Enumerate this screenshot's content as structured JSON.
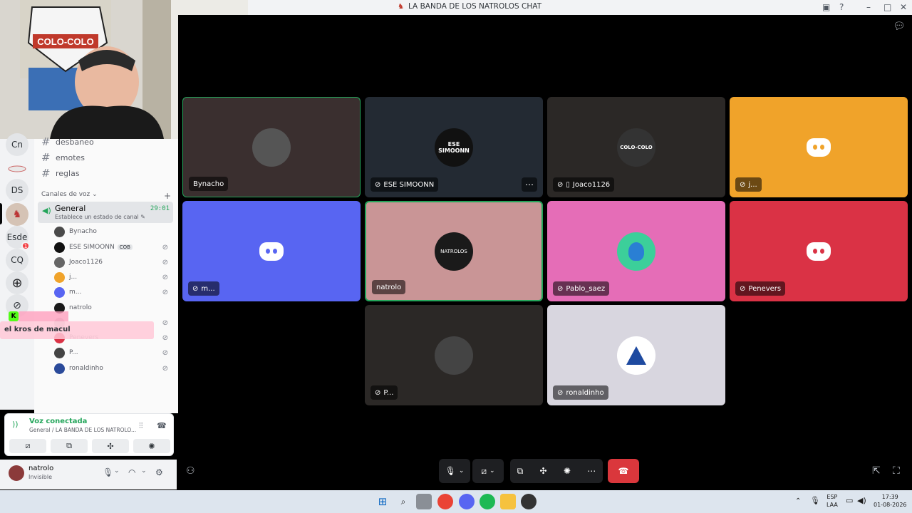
{
  "window": {
    "title": "LA BANDA DE LOS NATROLOS CHAT"
  },
  "servers": [
    "Cn",
    "DS",
    "Esde",
    "CQ"
  ],
  "server_badge": "1",
  "text_channels": [
    "desbaneo",
    "emotes",
    "reglas"
  ],
  "voice_category": "Canales de voz",
  "active_voice": {
    "name": "General",
    "status": "Establece un estado de canal",
    "timer": "29:01"
  },
  "voice_users": [
    {
      "name": "Bynacho"
    },
    {
      "name": "ESE SIMOONN",
      "tag": "COB"
    },
    {
      "name": "Joaco1126"
    },
    {
      "name": "j..."
    },
    {
      "name": "m..."
    },
    {
      "name": "natrolo"
    },
    {
      "name": "Penevers"
    },
    {
      "name": "P..."
    },
    {
      "name": "ronaldinho"
    }
  ],
  "overlay_text": "el kros de macul",
  "voice_panel": {
    "title": "Voz conectada",
    "subtitle": "General / LA BANDA DE LOS NATROLO..."
  },
  "user_panel": {
    "name": "natrolo",
    "status": "Invisible"
  },
  "webcam_text": "COLO-COLO",
  "tiles": [
    {
      "name": "Bynacho",
      "bg": "#3a2f2f",
      "avatar": "#555"
    },
    {
      "name": "ESE SIMOONN",
      "bg": "#232a33",
      "avatar": "#111"
    },
    {
      "name": "Joaco1126",
      "bg": "#2b2826",
      "avatar": "#333"
    },
    {
      "name": "j...",
      "bg": "#f0a32a",
      "avatar": "discord"
    },
    {
      "name": "m...",
      "bg": "#5865f2",
      "avatar": "discord"
    },
    {
      "name": "natrolo",
      "bg": "#c99596",
      "avatar": "#1a1a1a"
    },
    {
      "name": "Pablo_saez",
      "bg": "#e56db7",
      "avatar": "#3ccf9a"
    },
    {
      "name": "Penevers",
      "bg": "#da3245",
      "avatar": "discord"
    },
    {
      "name": "P...",
      "bg": "#2b2826",
      "avatar": "#444"
    },
    {
      "name": "ronaldinho",
      "bg": "#d8d6df",
      "avatar": "#fff"
    }
  ],
  "tray": {
    "lang": "ESP",
    "layout": "LAA",
    "time": "17:39",
    "date": "01-08-2026"
  }
}
